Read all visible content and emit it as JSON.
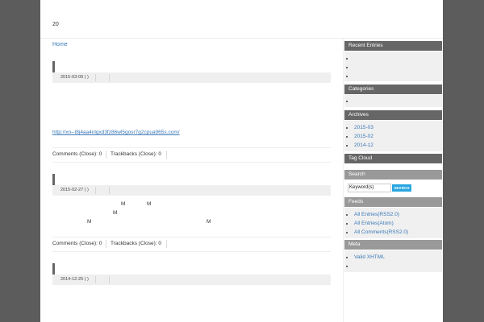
{
  "header": {
    "site_title": "20"
  },
  "breadcrumb": {
    "home": "Home"
  },
  "entries": [
    {
      "date": "2015-03-09 ( )",
      "link": "http://xn--t8j4aa4nlgxd3fz86wl5gosr7g2cpua965s.com/",
      "comments": "Comments (Close): 0",
      "trackbacks": "Trackbacks (Close): 0"
    },
    {
      "date": "2015-02-27 ( )",
      "body_chars": [
        "M",
        "M",
        "M",
        "M",
        "M"
      ],
      "comments": "Comments (Close): 0",
      "trackbacks": "Trackbacks (Close): 0"
    },
    {
      "date": "2014-12-25 ( )"
    }
  ],
  "sidebar": {
    "recent_entries": {
      "title": "Recent Entries",
      "items": [
        "",
        "",
        ""
      ]
    },
    "categories": {
      "title": "Categories",
      "items": [
        ""
      ]
    },
    "archives": {
      "title": "Archives",
      "items": [
        "2015-03",
        "2015-02",
        "2014-12"
      ]
    },
    "tag_cloud": {
      "title": "Tag Cloud"
    },
    "search": {
      "title": "Search",
      "input_value": "Keyword(s)",
      "button_label": "SEARCH"
    },
    "feeds": {
      "title": "Feeds",
      "items": [
        "All Entries(RSS2.0)",
        "All Entries(Atom)",
        "All Comments(RSS2.0)"
      ]
    },
    "meta": {
      "title": "Meta",
      "items": [
        "Valid XHTML",
        ""
      ]
    }
  }
}
